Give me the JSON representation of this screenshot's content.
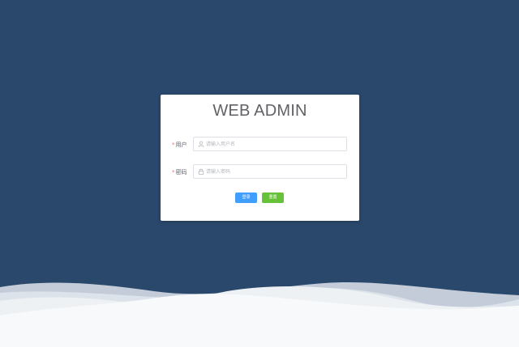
{
  "login": {
    "title": "WEB ADMIN",
    "username": {
      "required_mark": "*",
      "label": "用户",
      "placeholder": "请输入用户名",
      "icon": "user-icon"
    },
    "password": {
      "required_mark": "*",
      "label": "密码",
      "placeholder": "请输入密码",
      "icon": "lock-icon"
    },
    "login_button": "登录",
    "reset_button": "重置"
  },
  "colors": {
    "background": "#2a486c",
    "primary": "#409eff",
    "success": "#67c23a",
    "required": "#f56c6c"
  }
}
